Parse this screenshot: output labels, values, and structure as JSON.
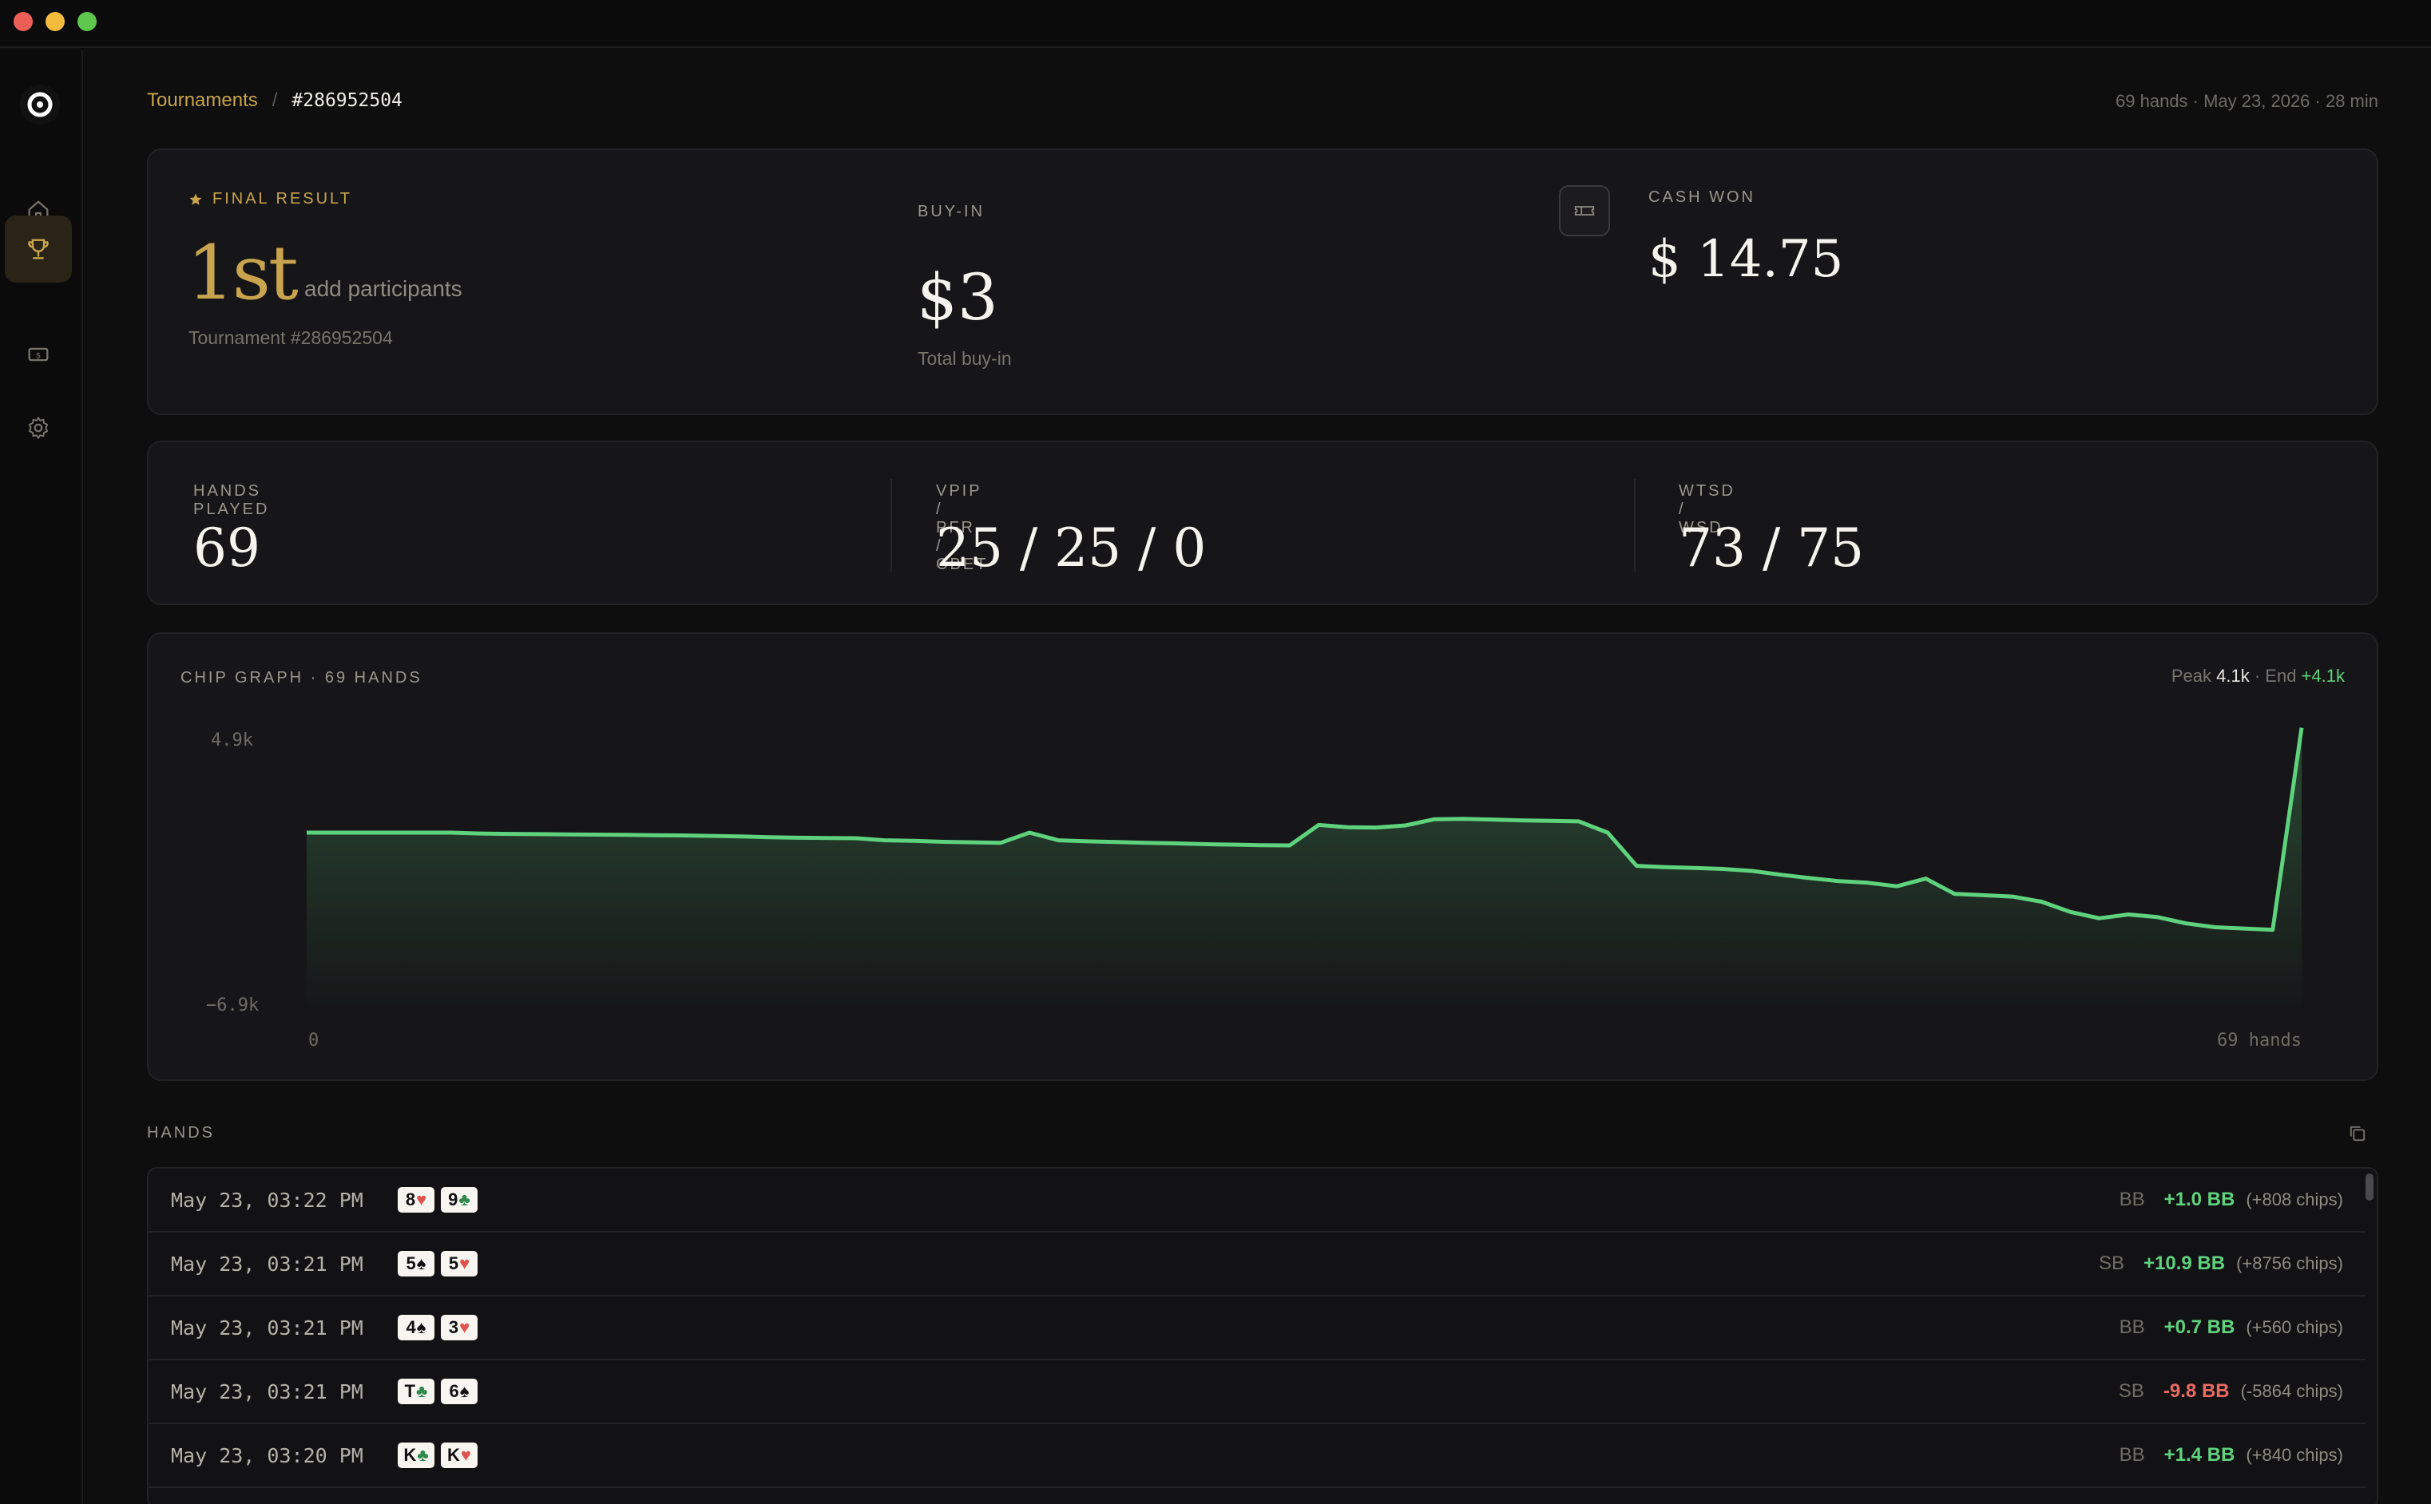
{
  "breadcrumb": {
    "parent": "Tournaments",
    "separator": "/",
    "current": "#286952504"
  },
  "meta": "69 hands · May 23, 2026 · 28 min",
  "result": {
    "final_label": "FINAL RESULT",
    "place": "1st",
    "add_participants": "add participants",
    "tournament_id": "Tournament #286952504",
    "buyin_label": "BUY-IN",
    "buyin_value": "$3",
    "buyin_sub": "Total buy-in",
    "cash_label": "CASH WON",
    "cash_value": "$ 14.75"
  },
  "stats": {
    "hands_label": "HANDS PLAYED",
    "hands_value": "69",
    "vpip_label": "VPIP / PFR / CBET",
    "vpip_value": "25 / 25 / 0",
    "wtsd_label": "WTSD / WSD",
    "wtsd_value": "73 / 75"
  },
  "chart": {
    "title": "CHIP GRAPH · 69 HANDS",
    "peak_label": "Peak",
    "peak_value": "4.1k",
    "end_label": "End",
    "end_value": "+4.1k",
    "sep": "·"
  },
  "chart_data": {
    "type": "area",
    "ylim": [
      -6900,
      4900
    ],
    "y_tick_labels": [
      "4.9k",
      "−6.9k"
    ],
    "x_tick_labels": [
      "0",
      "69 hands"
    ],
    "x": [
      0,
      1,
      2,
      3,
      4,
      5,
      6,
      7,
      8,
      9,
      10,
      11,
      12,
      13,
      14,
      15,
      16,
      17,
      18,
      19,
      20,
      21,
      22,
      23,
      24,
      25,
      26,
      27,
      28,
      29,
      30,
      31,
      32,
      33,
      34,
      35,
      36,
      37,
      38,
      39,
      40,
      41,
      42,
      43,
      44,
      45,
      46,
      47,
      48,
      49,
      50,
      51,
      52,
      53,
      54,
      55,
      56,
      57,
      58,
      59,
      60,
      61,
      62,
      63,
      64,
      65,
      66,
      67,
      68,
      69
    ],
    "values": [
      0,
      0,
      0,
      0,
      0,
      0,
      -35,
      -50,
      -60,
      -70,
      -80,
      -90,
      -100,
      -110,
      -130,
      -150,
      -180,
      -200,
      -210,
      -220,
      -300,
      -320,
      -360,
      -380,
      -400,
      0,
      -300,
      -340,
      -370,
      -400,
      -420,
      -450,
      -470,
      -490,
      -500,
      300,
      210,
      200,
      280,
      520,
      540,
      510,
      480,
      460,
      440,
      0,
      -1300,
      -1350,
      -1380,
      -1420,
      -1500,
      -1650,
      -1780,
      -1900,
      -1960,
      -2100,
      -1800,
      -2400,
      -2450,
      -2500,
      -2700,
      -3100,
      -3350,
      -3200,
      -3300,
      -3550,
      -3700,
      -3750,
      -3800,
      4100
    ],
    "series_color": "#5fd27d",
    "grid": false
  },
  "hands": {
    "label": "HANDS",
    "rows": [
      {
        "time": "May 23, 03:22 PM",
        "c1": "8",
        "s1": "♥",
        "c2": "9",
        "s2": "♣",
        "pos": "BB",
        "bb": "+1.0 BB",
        "chips": "(+808 chips)",
        "sign": "pos"
      },
      {
        "time": "May 23, 03:21 PM",
        "c1": "5",
        "s1": "♠",
        "c2": "5",
        "s2": "♥",
        "pos": "SB",
        "bb": "+10.9 BB",
        "chips": "(+8756 chips)",
        "sign": "pos"
      },
      {
        "time": "May 23, 03:21 PM",
        "c1": "4",
        "s1": "♠",
        "c2": "3",
        "s2": "♥",
        "pos": "BB",
        "bb": "+0.7 BB",
        "chips": "(+560 chips)",
        "sign": "pos"
      },
      {
        "time": "May 23, 03:21 PM",
        "c1": "T",
        "s1": "♣",
        "c2": "6",
        "s2": "♠",
        "pos": "SB",
        "bb": "-9.8 BB",
        "chips": "(-5864 chips)",
        "sign": "neg"
      },
      {
        "time": "May 23, 03:20 PM",
        "c1": "K",
        "s1": "♣",
        "c2": "K",
        "s2": "♥",
        "pos": "BB",
        "bb": "+1.4 BB",
        "chips": "(+840 chips)",
        "sign": "pos"
      }
    ]
  }
}
